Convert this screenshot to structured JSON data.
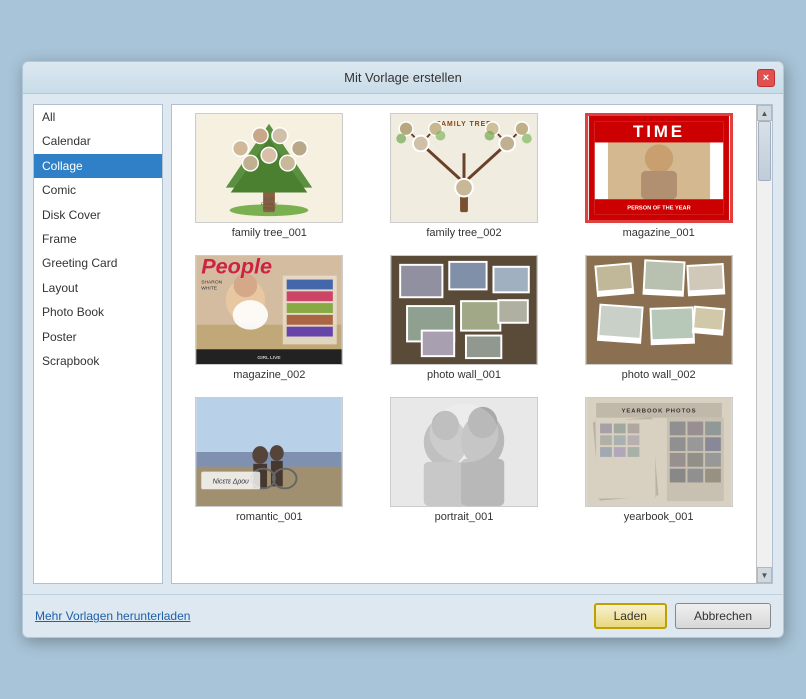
{
  "dialog": {
    "title": "Mit Vorlage erstellen",
    "close_label": "×"
  },
  "sidebar": {
    "items": [
      {
        "id": "all",
        "label": "All",
        "selected": false
      },
      {
        "id": "calendar",
        "label": "Calendar",
        "selected": false
      },
      {
        "id": "collage",
        "label": "Collage",
        "selected": true
      },
      {
        "id": "comic",
        "label": "Comic",
        "selected": false
      },
      {
        "id": "disk_cover",
        "label": "Disk Cover",
        "selected": false
      },
      {
        "id": "frame",
        "label": "Frame",
        "selected": false
      },
      {
        "id": "greeting_card",
        "label": "Greeting Card",
        "selected": false
      },
      {
        "id": "layout",
        "label": "Layout",
        "selected": false
      },
      {
        "id": "photo_book",
        "label": "Photo Book",
        "selected": false
      },
      {
        "id": "poster",
        "label": "Poster",
        "selected": false
      },
      {
        "id": "scrapbook",
        "label": "Scrapbook",
        "selected": false
      }
    ]
  },
  "templates": [
    {
      "id": "ft1",
      "label": "family tree_001",
      "selected": false
    },
    {
      "id": "ft2",
      "label": "family tree_002",
      "selected": false
    },
    {
      "id": "mag1",
      "label": "magazine_001",
      "selected": true
    },
    {
      "id": "mag2",
      "label": "magazine_002",
      "selected": false
    },
    {
      "id": "pw1",
      "label": "photo wall_001",
      "selected": false
    },
    {
      "id": "pw2",
      "label": "photo wall_002",
      "selected": false
    },
    {
      "id": "row3a",
      "label": "romantic_001",
      "selected": false
    },
    {
      "id": "row3b",
      "label": "portrait_001",
      "selected": false
    },
    {
      "id": "row3c",
      "label": "yearbook_001",
      "selected": false
    }
  ],
  "footer": {
    "link_label": "Mehr Vorlagen herunterladen",
    "load_button": "Laden",
    "cancel_button": "Abbrechen"
  }
}
